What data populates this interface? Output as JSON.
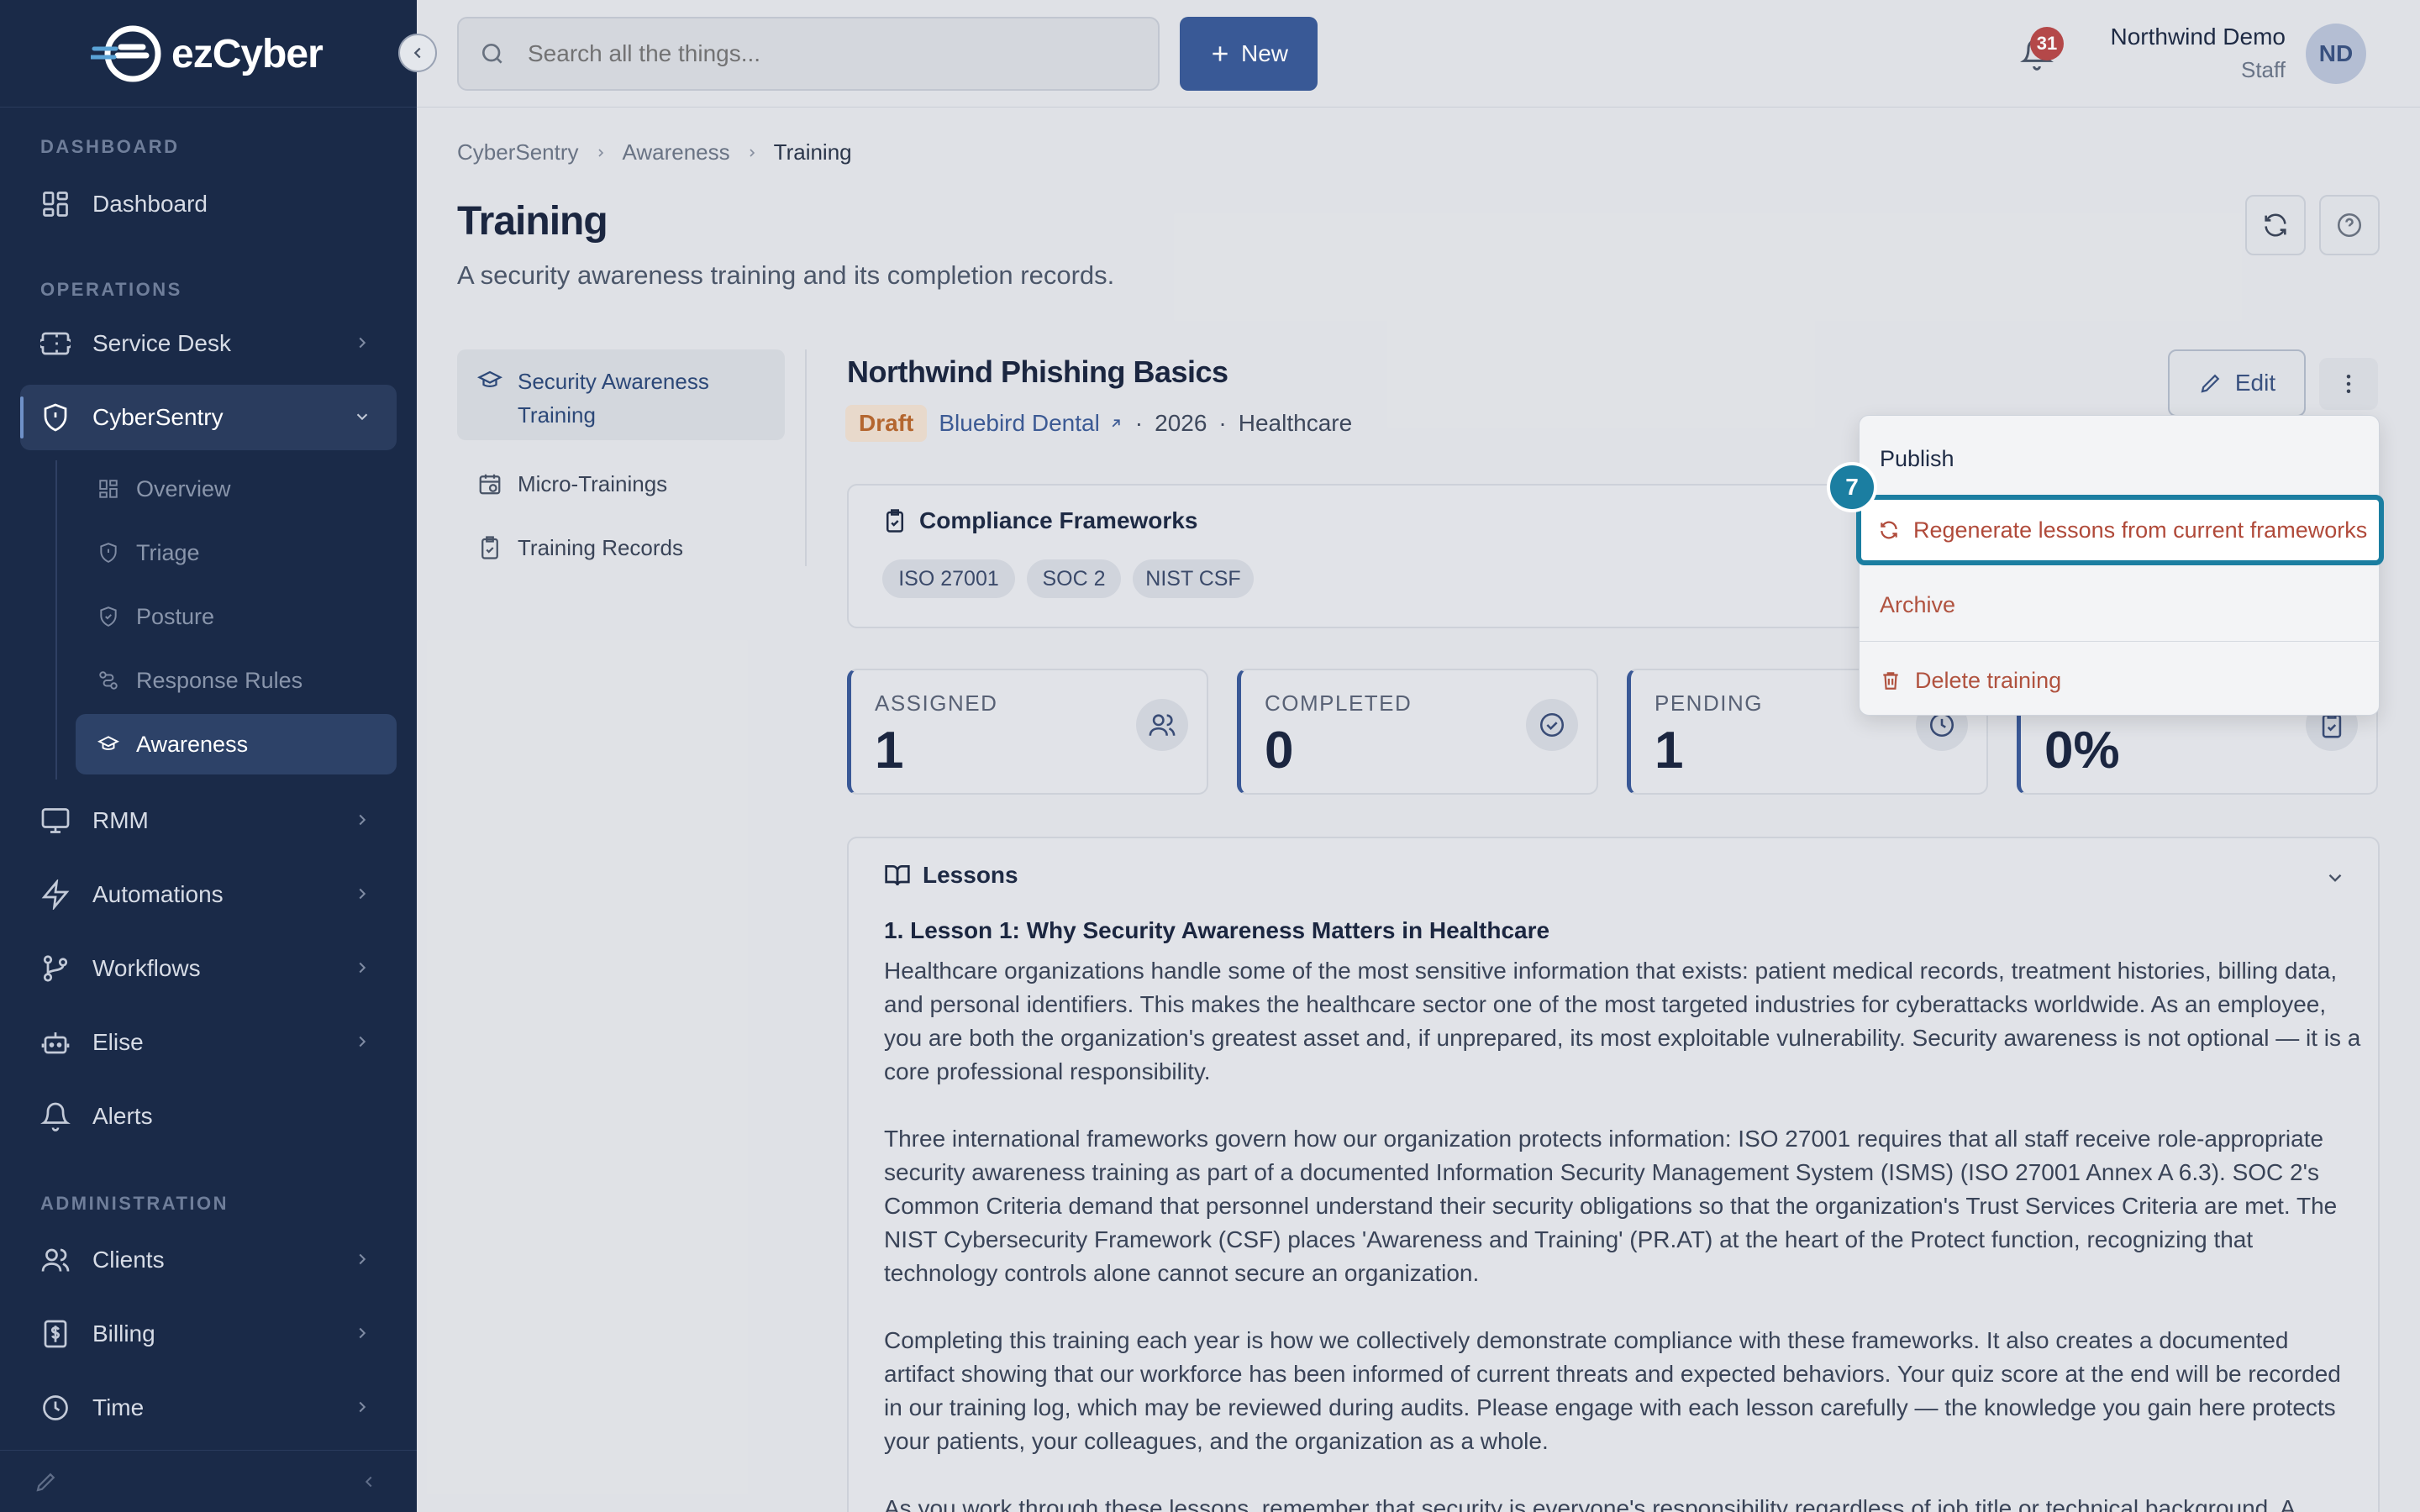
{
  "brand": {
    "name": "ezCyber"
  },
  "sidebar": {
    "sections": {
      "dashboard": "DASHBOARD",
      "operations": "OPERATIONS",
      "administration": "ADMINISTRATION"
    },
    "items": {
      "dashboard": "Dashboard",
      "service_desk": "Service Desk",
      "cybersentry": "CyberSentry",
      "rmm": "RMM",
      "automations": "Automations",
      "workflows": "Workflows",
      "elise": "Elise",
      "alerts": "Alerts",
      "clients": "Clients",
      "billing": "Billing",
      "time": "Time"
    },
    "sub_items": {
      "overview": "Overview",
      "triage": "Triage",
      "posture": "Posture",
      "response_rules": "Response Rules",
      "awareness": "Awareness"
    }
  },
  "topbar": {
    "search_placeholder": "Search all the things...",
    "new_label": "New",
    "notification_count": "31",
    "user_name": "Northwind Demo",
    "user_role": "Staff",
    "user_initials": "ND"
  },
  "breadcrumb": {
    "items": [
      "CyberSentry",
      "Awareness",
      "Training"
    ]
  },
  "page": {
    "title": "Training",
    "subtitle": "A security awareness training and its completion records."
  },
  "left_nav": {
    "security_awareness_line1": "Security Awareness",
    "security_awareness_line2": "Training",
    "micro_trainings": "Micro-Trainings",
    "training_records": "Training Records"
  },
  "training": {
    "title": "Northwind Phishing Basics",
    "status": "Draft",
    "client": "Bluebird Dental",
    "year": "2026",
    "industry": "Healthcare",
    "edit_label": "Edit",
    "separator": "·"
  },
  "frameworks": {
    "heading": "Compliance Frameworks",
    "chips": [
      "ISO 27001",
      "SOC 2",
      "NIST CSF"
    ]
  },
  "stats": {
    "assigned": {
      "label": "ASSIGNED",
      "value": "1"
    },
    "completed": {
      "label": "COMPLETED",
      "value": "0"
    },
    "pending": {
      "label": "PENDING",
      "value": "1"
    },
    "rate": {
      "value": "0%"
    }
  },
  "lessons": {
    "heading": "Lessons",
    "lesson1_title": "1. Lesson 1: Why Security Awareness Matters in Healthcare",
    "paragraphs": [
      "Healthcare organizations handle some of the most sensitive information that exists: patient medical records, treatment histories, billing data, and personal identifiers. This makes the healthcare sector one of the most targeted industries for cyberattacks worldwide. As an employee, you are both the organization's greatest asset and, if unprepared, its most exploitable vulnerability. Security awareness is not optional — it is a core professional responsibility.",
      "Three international frameworks govern how our organization protects information: ISO 27001 requires that all staff receive role-appropriate security awareness training as part of a documented Information Security Management System (ISMS) (ISO 27001 Annex A 6.3). SOC 2's Common Criteria demand that personnel understand their security obligations so that the organization's Trust Services Criteria are met. The NIST Cybersecurity Framework (CSF) places 'Awareness and Training' (PR.AT) at the heart of the Protect function, recognizing that technology controls alone cannot secure an organization.",
      "Completing this training each year is how we collectively demonstrate compliance with these frameworks. It also creates a documented artifact showing that our workforce has been informed of current threats and expected behaviors. Your quiz score at the end will be recorded in our training log, which may be reviewed during audits. Please engage with each lesson carefully — the knowledge you gain here protects your patients, your colleagues, and the organization as a whole.",
      "As you work through these lessons, remember that security is everyone's responsibility regardless of job title or technical background. A"
    ]
  },
  "menu": {
    "publish": "Publish",
    "regenerate": "Regenerate lessons from current frameworks",
    "archive": "Archive",
    "delete": "Delete training",
    "step_number": "7"
  }
}
